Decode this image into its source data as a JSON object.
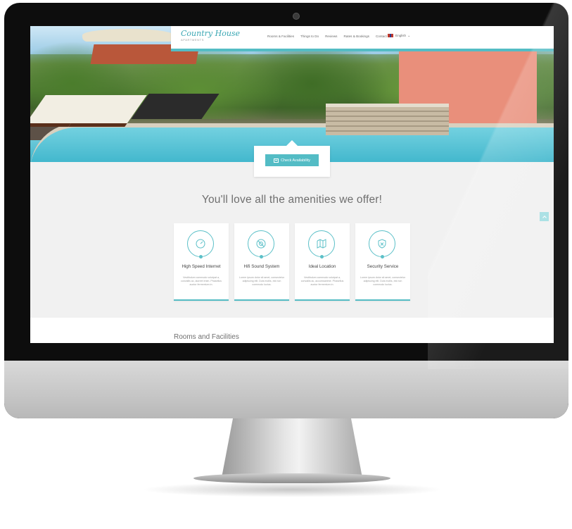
{
  "site": {
    "brand_name": "Country House",
    "brand_tagline": "APARTMENTS"
  },
  "nav": {
    "items": [
      "Rooms & Facilities",
      "Things to Do",
      "Reviews",
      "Rates & Bookings",
      "Contact"
    ],
    "language": "English"
  },
  "hero": {
    "availability_button": "Check Availability"
  },
  "amenities": {
    "heading": "You'll love all the amenities we offer!",
    "cards": [
      {
        "title": "High Speed Internet",
        "icon": "speedometer-icon",
        "desc": "Vestibulum commodo volutpat a, convallis ac, laoreet enim. Phasellus auctor fermentum in."
      },
      {
        "title": "Hifi Sound System",
        "icon": "speaker-icon",
        "desc": "Lorem ipsum dolor sit amet, consectetur adipiscing elit. Duis mollis, est non commodo luctus."
      },
      {
        "title": "Ideal Location",
        "icon": "map-icon",
        "desc": "Vestibulum commodo volutpat a, convallis ac, accumsantme. Phasellus auctor fermentum in."
      },
      {
        "title": "Security Service",
        "icon": "shield-icon",
        "desc": "Lorem ipsum dolor sit amet, consectetur adipiscing elit. Duis mollis, est non commodo luctus."
      }
    ]
  },
  "section": {
    "title": "Rooms and Facilities"
  },
  "colors": {
    "accent": "#54bcc4",
    "text": "#6f6f6f",
    "background": "#f1f1f1"
  }
}
